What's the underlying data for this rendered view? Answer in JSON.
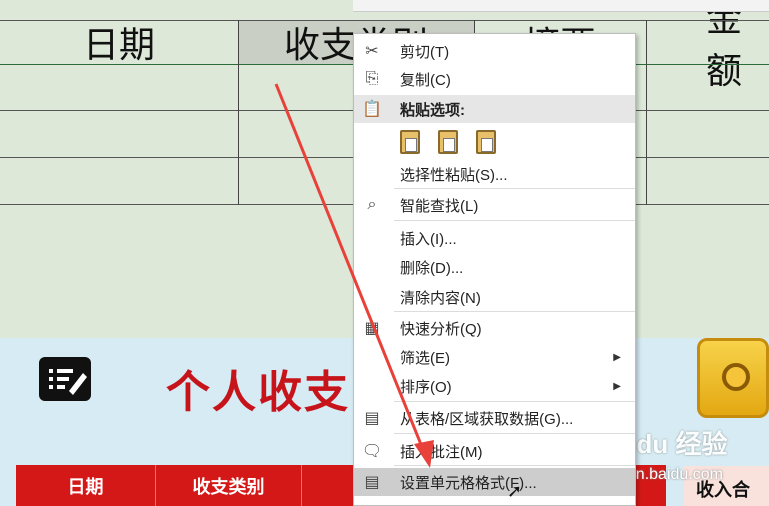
{
  "sheet": {
    "headers": [
      "日期",
      "收支类别",
      "摘要",
      "金额"
    ]
  },
  "band": {
    "title": "个人收支",
    "table_headers": [
      "日期",
      "收支类别"
    ],
    "income_label": "收入合"
  },
  "watermark": {
    "brand": "Baidu 经验",
    "url": "jingyan.baidu.com"
  },
  "menu": {
    "items": [
      {
        "label": "剪切(T)",
        "icon": "scissors-icon"
      },
      {
        "label": "复制(C)",
        "icon": "copy-icon"
      },
      {
        "label": "粘贴选项:",
        "icon": "paste-icon"
      },
      {
        "label": "选择性粘贴(S)...",
        "icon": ""
      },
      {
        "label": "智能查找(L)",
        "icon": "smart-lookup-icon"
      },
      {
        "label": "插入(I)...",
        "icon": ""
      },
      {
        "label": "删除(D)...",
        "icon": ""
      },
      {
        "label": "清除内容(N)",
        "icon": ""
      },
      {
        "label": "快速分析(Q)",
        "icon": "quick-analysis-icon"
      },
      {
        "label": "筛选(E)",
        "icon": ""
      },
      {
        "label": "排序(O)",
        "icon": ""
      },
      {
        "label": "从表格/区域获取数据(G)...",
        "icon": "table-icon"
      },
      {
        "label": "插入批注(M)",
        "icon": "comment-icon"
      },
      {
        "label": "设置单元格格式(F)...",
        "icon": "format-cells-icon"
      }
    ]
  },
  "colors": {
    "accent_red": "#c7141b",
    "table_red": "#d41818",
    "arrow_red": "#e8413a"
  }
}
